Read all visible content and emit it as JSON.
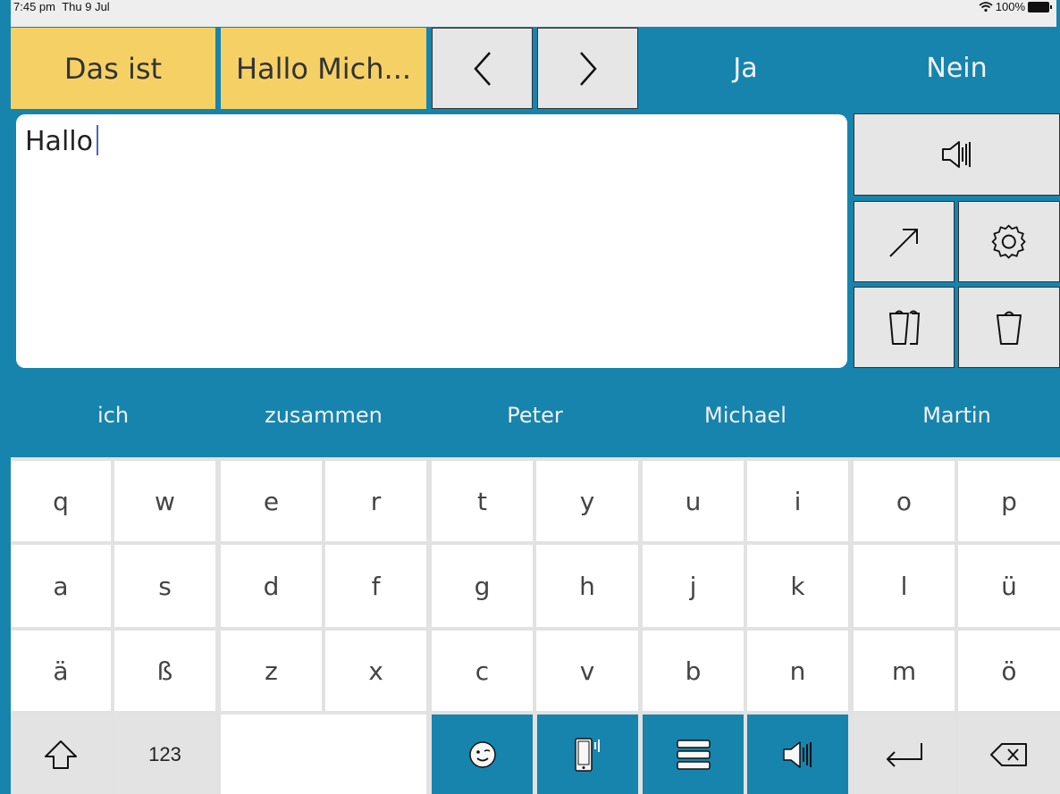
{
  "status_bar": {
    "time": "7:45 pm",
    "date": "Thu 9 Jul",
    "battery": "100%"
  },
  "top_row": {
    "phrase1": "Das ist",
    "phrase2": "Hallo Mich...",
    "prev_icon": "chevron-left-icon",
    "next_icon": "chevron-right-icon",
    "yes": "Ja",
    "no": "Nein"
  },
  "editor": {
    "text": "Hallo"
  },
  "side_buttons": {
    "speak_icon": "speaker-icon",
    "share_icon": "arrow-up-right-icon",
    "settings_icon": "gear-icon",
    "delete_word_icon": "trash-multi-icon",
    "clear_icon": "trash-icon"
  },
  "suggestions": [
    "ich",
    "zusammen",
    "Peter",
    "Michael",
    "Martin"
  ],
  "keyboard": {
    "row1": [
      "q",
      "w",
      "e",
      "r",
      "t",
      "y",
      "u",
      "i",
      "o",
      "p"
    ],
    "row2": [
      "a",
      "s",
      "d",
      "f",
      "g",
      "h",
      "j",
      "k",
      "l",
      "ü"
    ],
    "row3": [
      "ä",
      "ß",
      "z",
      "x",
      "c",
      "v",
      "b",
      "n",
      "m",
      "ö"
    ],
    "bottom": {
      "shift_icon": "shift-arrow-icon",
      "numbers_label": "123",
      "emoji_icon": "emoji-face-icon",
      "device_icon": "phone-vibrate-icon",
      "menu_icon": "menu-icon",
      "speak_icon": "speaker-icon",
      "return_icon": "return-arrow-icon",
      "backspace_icon": "backspace-icon"
    }
  },
  "colors": {
    "accent_blue": "#1784ad",
    "phrase_yellow": "#f5d165"
  }
}
